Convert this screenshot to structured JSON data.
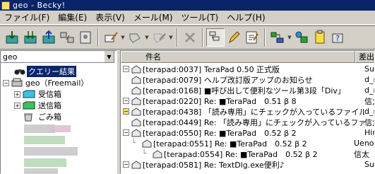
{
  "window": {
    "title": "geo - Becky!"
  },
  "menu": [
    "ファイル(F)",
    "編集(E)",
    "表示(V)",
    "メール(M)",
    "ツール(T)",
    "ヘルプ(H)"
  ],
  "toolbar_icons": [
    "receive-icon",
    "receive-all-icon",
    "send-icon",
    "sync-icon",
    "address-book-icon",
    "compose-icon",
    "reply-icon",
    "forward-icon",
    "delete-icon",
    "thread-view-icon",
    "edit-icon",
    "properties-icon",
    "filter-icon",
    "settings-icon",
    "notes-icon",
    "help-icon"
  ],
  "mailbox_combo": {
    "value": "geo"
  },
  "tree": {
    "query_results": "クエリー結果",
    "account": "geo（Freemail）",
    "inbox": "受信箱",
    "outbox": "送信箱",
    "trash": "ごみ箱"
  },
  "list": {
    "columns": {
      "subject": "件名",
      "from": "差出"
    },
    "rows": [
      {
        "subject": "[terapad:0037] TeraPad 0.50 正式版",
        "from": "Susu"
      },
      {
        "subject": "[terapad:0079] ヘルプ改訂版アップのお知らせ",
        "from": "d_mai"
      },
      {
        "subject": "[terapad:0168] ■呼び出して便利なツール第3段「Div」",
        "from": "d_mai"
      },
      {
        "subject": "[terapad:0220] Re: ■TeraPad　0.51 β 8",
        "from": "信太"
      },
      {
        "subject": "[terapad:0438] 「読み専用」にチェックが入っているファイル...",
        "from": "d_mai"
      },
      {
        "subject": "[terapad:0449] Re: 「読み専用」にチェックが入っているファイ...",
        "from": "信太"
      },
      {
        "subject": "[terapad:0550] Re: ■TeraPad　0.52 β 2",
        "from": "Hirok"
      },
      {
        "subject": "[terapad:0551] Re: ■TeraPad　0.52 β 2",
        "from": "Ueno"
      },
      {
        "subject": "[terapad:0554] Re: ■TeraPad　0.52 β 2",
        "from": "信太"
      },
      {
        "subject": "[terapad:0581] Re: TextDlg.exe便利♪",
        "from": "Susu"
      }
    ]
  },
  "colors": {
    "titlebar": "#0a246a",
    "selection": "#0a246a",
    "chrome": "#d4d0c8"
  }
}
